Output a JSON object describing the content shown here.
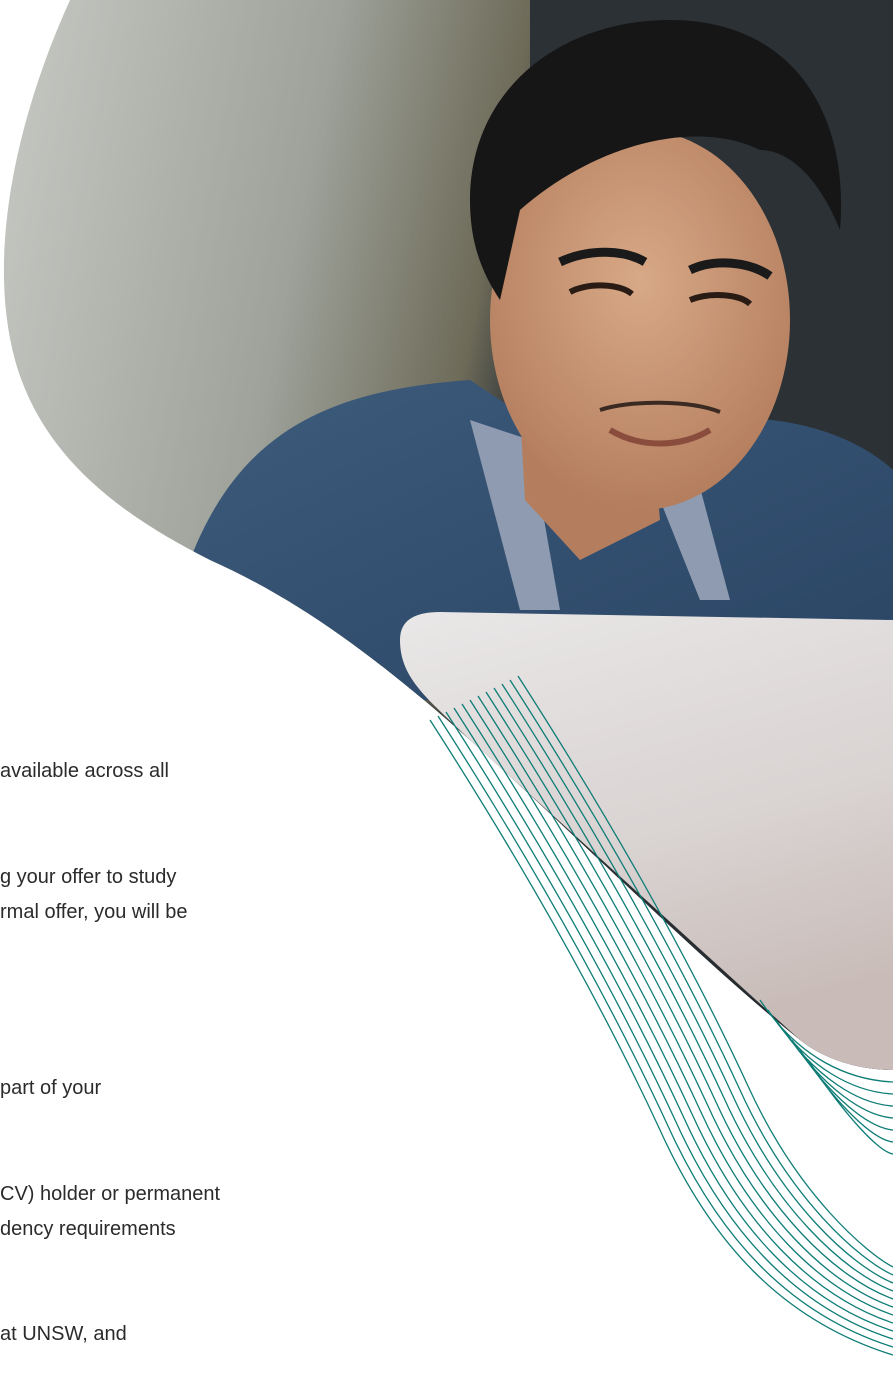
{
  "colors": {
    "accent_teal": "#0f7d77",
    "text": "#2b2b2b"
  },
  "photo": {
    "subject": "man-with-laptop-icon"
  },
  "body_text": {
    "line1": "available across all",
    "line2": "g your offer to study",
    "line3": "rmal offer, you will be",
    "line4": "part of your",
    "line5": "CV) holder or permanent",
    "line6": "dency requirements",
    "line7": "at UNSW, and"
  }
}
